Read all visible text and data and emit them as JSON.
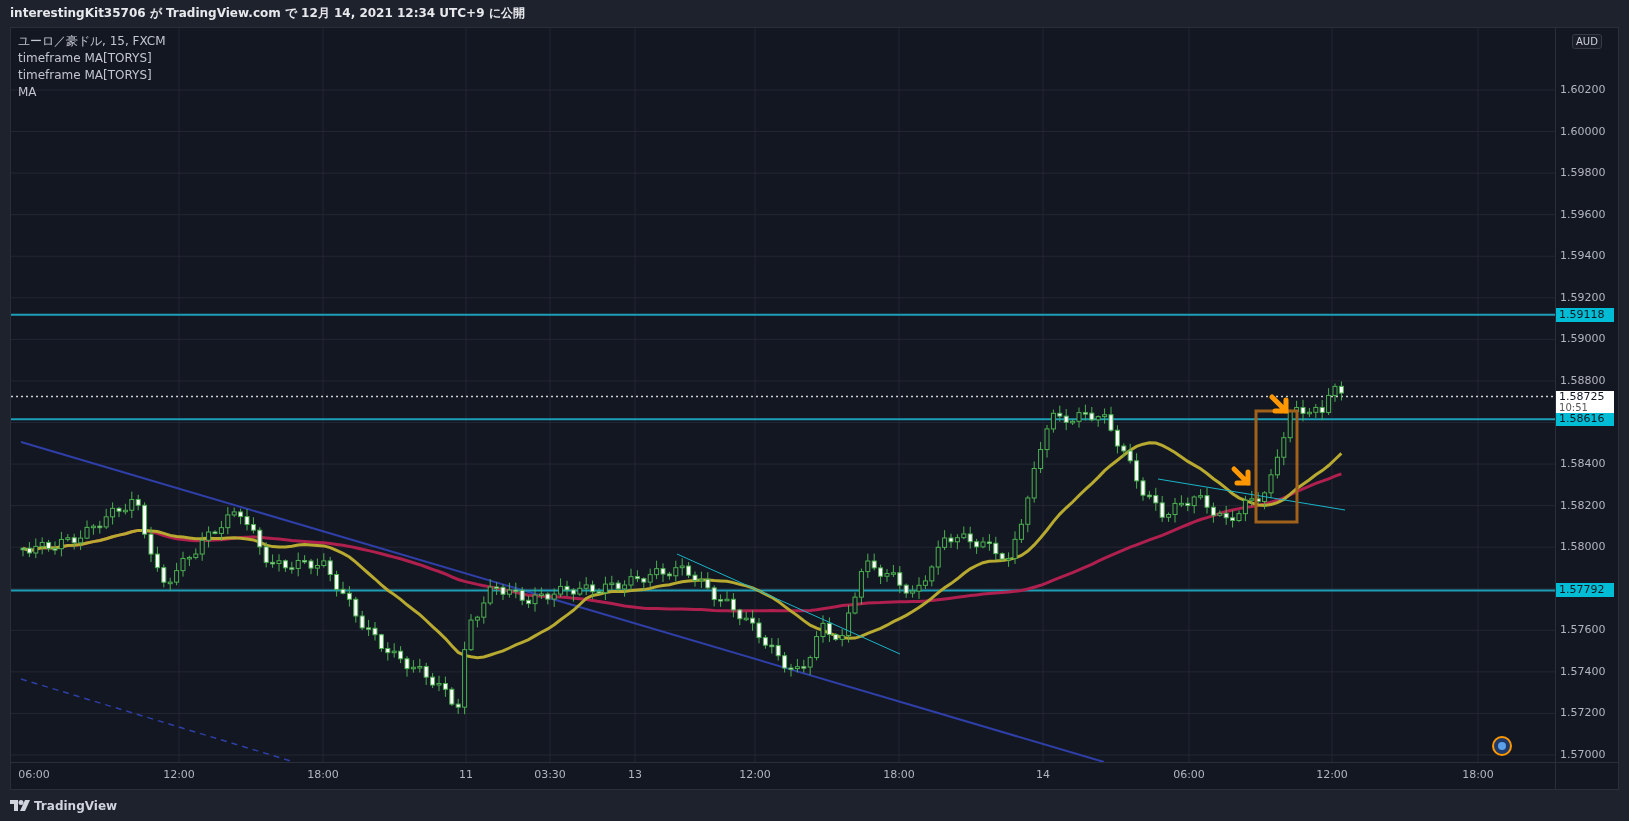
{
  "header": {
    "title": "interestingKit35706 が TradingView.com で 12月 14, 2021 12:34 UTC+9 に公開"
  },
  "legend": [
    "ユーロ／豪ドル, 15, FXCM",
    "timeframe MA[TORYS]",
    "timeframe MA[TORYS]",
    "MA"
  ],
  "price_axis": {
    "currency": "AUD",
    "ticks": [
      "1.60200",
      "1.60000",
      "1.59800",
      "1.59600",
      "1.59400",
      "1.59200",
      "1.59000",
      "1.58800",
      "1.58400",
      "1.58200",
      "1.58000",
      "1.57600",
      "1.57400",
      "1.57200",
      "1.57000"
    ],
    "badges": [
      {
        "kind": "level",
        "text": "1.59118"
      },
      {
        "kind": "last",
        "text": "1.58725",
        "countdown": "10:51"
      },
      {
        "kind": "level",
        "text": "1.58616"
      },
      {
        "kind": "level",
        "text": "1.57792"
      }
    ]
  },
  "time_axis": [
    "06:00",
    "12:00",
    "18:00",
    "11",
    "03:30",
    "13",
    "12:00",
    "18:00",
    "14",
    "06:00",
    "12:00",
    "18:00"
  ],
  "footer": {
    "brand": "TradingView"
  }
}
